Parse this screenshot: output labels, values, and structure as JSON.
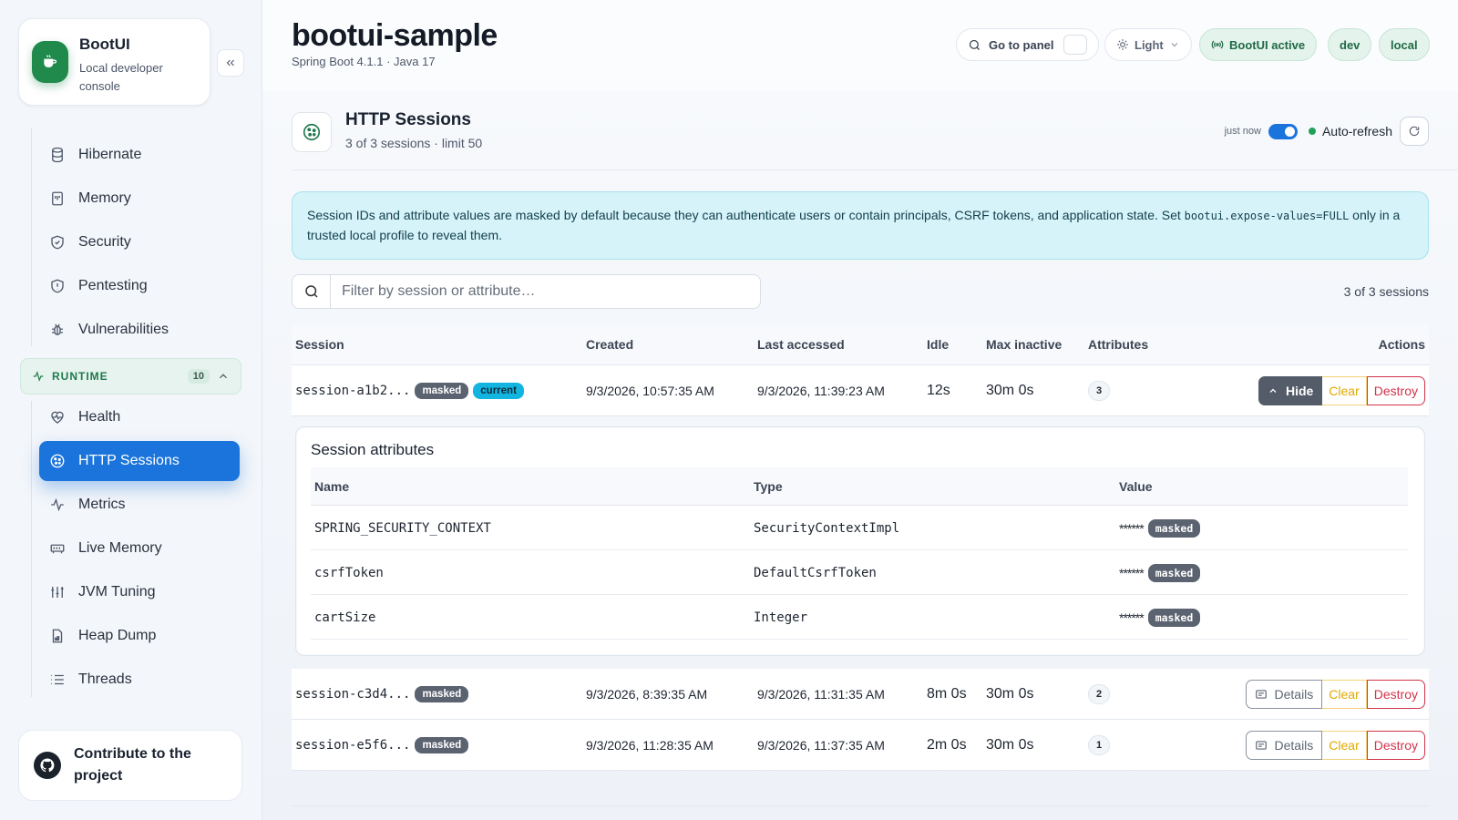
{
  "brand": {
    "title": "BootUI",
    "subtitle": "Local developer console"
  },
  "nav": {
    "items_top": [
      {
        "label": "Hibernate",
        "icon": "database-icon"
      },
      {
        "label": "Memory",
        "icon": "memory-icon"
      },
      {
        "label": "Security",
        "icon": "shield-icon"
      },
      {
        "label": "Pentesting",
        "icon": "shield-alert-icon"
      },
      {
        "label": "Vulnerabilities",
        "icon": "bug-icon"
      }
    ],
    "group": {
      "label": "RUNTIME",
      "count": "10"
    },
    "items_runtime": [
      {
        "label": "Health",
        "icon": "heart-pulse-icon"
      },
      {
        "label": "HTTP Sessions",
        "icon": "cookie-icon",
        "active": true
      },
      {
        "label": "Metrics",
        "icon": "activity-icon"
      },
      {
        "label": "Live Memory",
        "icon": "memory-stick-icon"
      },
      {
        "label": "JVM Tuning",
        "icon": "sliders-icon"
      },
      {
        "label": "Heap Dump",
        "icon": "file-icon"
      },
      {
        "label": "Threads",
        "icon": "list-icon"
      }
    ],
    "contribute": "Contribute to the project"
  },
  "header": {
    "title": "bootui-sample",
    "subtitle": "Spring Boot 4.1.1 · Java 17",
    "go_to_panel": "Go to panel",
    "theme": "Light",
    "status": "BootUI active",
    "profiles": [
      "dev",
      "local"
    ]
  },
  "panel": {
    "title": "HTTP Sessions",
    "subtitle": "3 of 3 sessions · limit 50",
    "updated": "just now",
    "auto_refresh": "Auto-refresh",
    "auto_refresh_on": true
  },
  "alert": {
    "text_before": "Session IDs and attribute values are masked by default because they can authenticate users or contain principals, CSRF tokens, and application state. Set ",
    "code": "bootui.expose-values=FULL",
    "text_after": " only in a trusted local profile to reveal them."
  },
  "filter": {
    "placeholder": "Filter by session or attribute…",
    "count": "3 of 3 sessions"
  },
  "table": {
    "headers": [
      "Session",
      "Created",
      "Last accessed",
      "Idle",
      "Max inactive",
      "Attributes",
      "Actions"
    ],
    "rows": [
      {
        "id": "session-a1b2...",
        "badges": [
          "masked",
          "current"
        ],
        "created": "9/3/2026, 10:57:35 AM",
        "last": "9/3/2026, 11:39:23 AM",
        "idle": "12s",
        "max": "30m 0s",
        "attrs": "3",
        "toggle": "Hide",
        "clear": "Clear",
        "destroy": "Destroy"
      },
      {
        "id": "session-c3d4...",
        "badges": [
          "masked"
        ],
        "created": "9/3/2026, 8:39:35 AM",
        "last": "9/3/2026, 11:31:35 AM",
        "idle": "8m 0s",
        "max": "30m 0s",
        "attrs": "2",
        "toggle": "Details",
        "clear": "Clear",
        "destroy": "Destroy"
      },
      {
        "id": "session-e5f6...",
        "badges": [
          "masked"
        ],
        "created": "9/3/2026, 11:28:35 AM",
        "last": "9/3/2026, 11:37:35 AM",
        "idle": "2m 0s",
        "max": "30m 0s",
        "attrs": "1",
        "toggle": "Details",
        "clear": "Clear",
        "destroy": "Destroy"
      }
    ]
  },
  "attributes": {
    "title": "Session attributes",
    "headers": [
      "Name",
      "Type",
      "Value"
    ],
    "rows": [
      {
        "name": "SPRING_SECURITY_CONTEXT",
        "type": "SecurityContextImpl",
        "value": "******",
        "badge": "masked"
      },
      {
        "name": "csrfToken",
        "type": "DefaultCsrfToken",
        "value": "******",
        "badge": "masked"
      },
      {
        "name": "cartSize",
        "type": "Integer",
        "value": "******",
        "badge": "masked"
      }
    ]
  },
  "colors": {
    "accent": "#1a74db",
    "brand_green": "#1f8a4c",
    "destroy": "#d1344a",
    "clear": "#e0a800",
    "alert_bg": "#d6f3f9"
  }
}
